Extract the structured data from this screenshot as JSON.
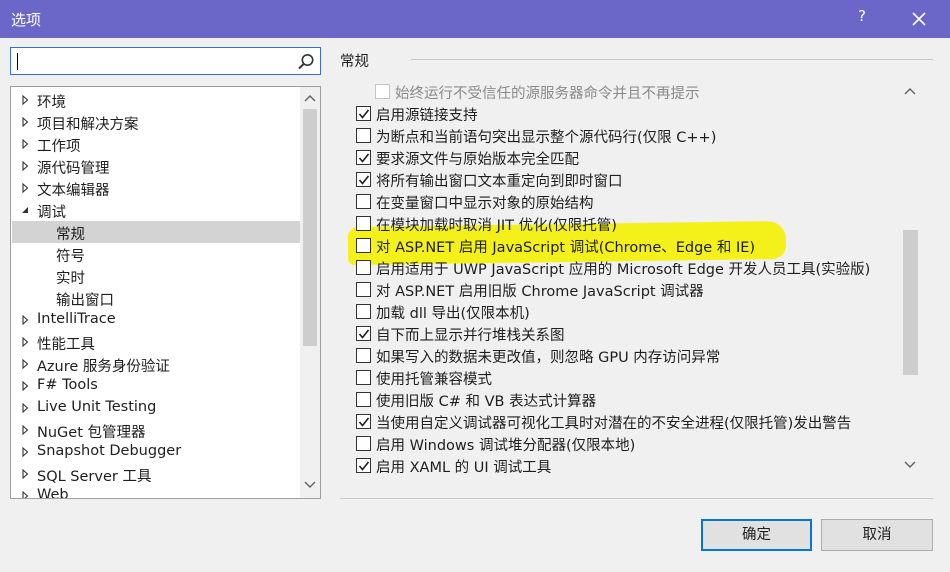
{
  "window": {
    "title": "选项",
    "help_label": "?",
    "close_icon": "close-icon"
  },
  "search": {
    "value": "",
    "icon": "search-icon"
  },
  "tree": {
    "items": [
      {
        "label": "环境",
        "expanded": false,
        "level": 0
      },
      {
        "label": "项目和解决方案",
        "expanded": false,
        "level": 0
      },
      {
        "label": "工作项",
        "expanded": false,
        "level": 0
      },
      {
        "label": "源代码管理",
        "expanded": false,
        "level": 0
      },
      {
        "label": "文本编辑器",
        "expanded": false,
        "level": 0
      },
      {
        "label": "调试",
        "expanded": true,
        "level": 0
      },
      {
        "label": "常规",
        "level": 1,
        "selected": true
      },
      {
        "label": "符号",
        "level": 1
      },
      {
        "label": "实时",
        "level": 1
      },
      {
        "label": "输出窗口",
        "level": 1
      },
      {
        "label": "IntelliTrace",
        "expanded": false,
        "level": 0
      },
      {
        "label": "性能工具",
        "expanded": false,
        "level": 0
      },
      {
        "label": "Azure 服务身份验证",
        "expanded": false,
        "level": 0
      },
      {
        "label": "F# Tools",
        "expanded": false,
        "level": 0
      },
      {
        "label": "Live Unit Testing",
        "expanded": false,
        "level": 0
      },
      {
        "label": "NuGet 包管理器",
        "expanded": false,
        "level": 0
      },
      {
        "label": "Snapshot Debugger",
        "expanded": false,
        "level": 0
      },
      {
        "label": "SQL Server 工具",
        "expanded": false,
        "level": 0
      },
      {
        "label": "Web",
        "expanded": false,
        "level": 0
      }
    ]
  },
  "section": {
    "title": "常规"
  },
  "options": [
    {
      "label": "始终运行不受信任的源服务器命令并且不再提示",
      "checked": false,
      "disabled": true,
      "indent": true
    },
    {
      "label": "启用源链接支持",
      "checked": true
    },
    {
      "label": "为断点和当前语句突出显示整个源代码行(仅限 C++)",
      "checked": false
    },
    {
      "label": "要求源文件与原始版本完全匹配",
      "checked": true
    },
    {
      "label": "将所有输出窗口文本重定向到即时窗口",
      "checked": true
    },
    {
      "label": "在变量窗口中显示对象的原始结构",
      "checked": false
    },
    {
      "label": "在模块加载时取消 JIT 优化(仅限托管)",
      "checked": false
    },
    {
      "label": "对 ASP.NET 启用 JavaScript 调试(Chrome、Edge 和 IE)",
      "checked": false,
      "highlighted": true
    },
    {
      "label": "启用适用于 UWP JavaScript 应用的 Microsoft Edge 开发人员工具(实验版)",
      "checked": false
    },
    {
      "label": "对 ASP.NET 启用旧版 Chrome JavaScript 调试器",
      "checked": false
    },
    {
      "label": "加载 dll 导出(仅限本机)",
      "checked": false
    },
    {
      "label": "自下而上显示并行堆栈关系图",
      "checked": true
    },
    {
      "label": "如果写入的数据未更改值，则忽略 GPU 内存访问异常",
      "checked": false
    },
    {
      "label": "使用托管兼容模式",
      "checked": false
    },
    {
      "label": "使用旧版 C# 和 VB 表达式计算器",
      "checked": false
    },
    {
      "label": "当使用自定义调试器可视化工具时对潜在的不安全进程(仅限托管)发出警告",
      "checked": true
    },
    {
      "label": "启用 Windows 调试堆分配器(仅限本地)",
      "checked": false
    },
    {
      "label": "启用 XAML 的 UI 调试工具",
      "checked": true
    }
  ],
  "buttons": {
    "ok": "确定",
    "cancel": "取消"
  },
  "colors": {
    "titlebar": "#6a67c8",
    "highlight": "#f4f11a",
    "accent": "#0078d7"
  }
}
